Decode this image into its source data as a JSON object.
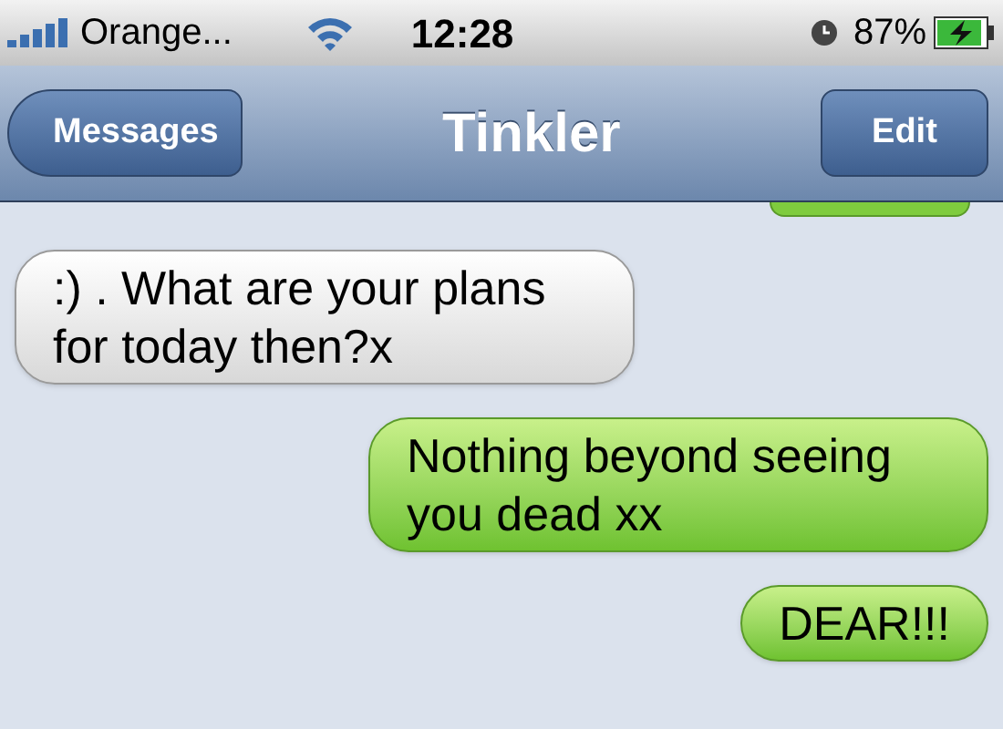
{
  "status_bar": {
    "carrier": "Orange...",
    "time": "12:28",
    "battery": "87%"
  },
  "nav_bar": {
    "back": "Messages",
    "title": "Tinkler",
    "action": "Edit"
  },
  "messages": [
    {
      "kind": "received",
      "text": ":) . What are your plans for today then?x"
    },
    {
      "kind": "sent",
      "text": "Nothing beyond seeing you dead xx"
    },
    {
      "kind": "sent",
      "text": "DEAR!!!"
    }
  ]
}
